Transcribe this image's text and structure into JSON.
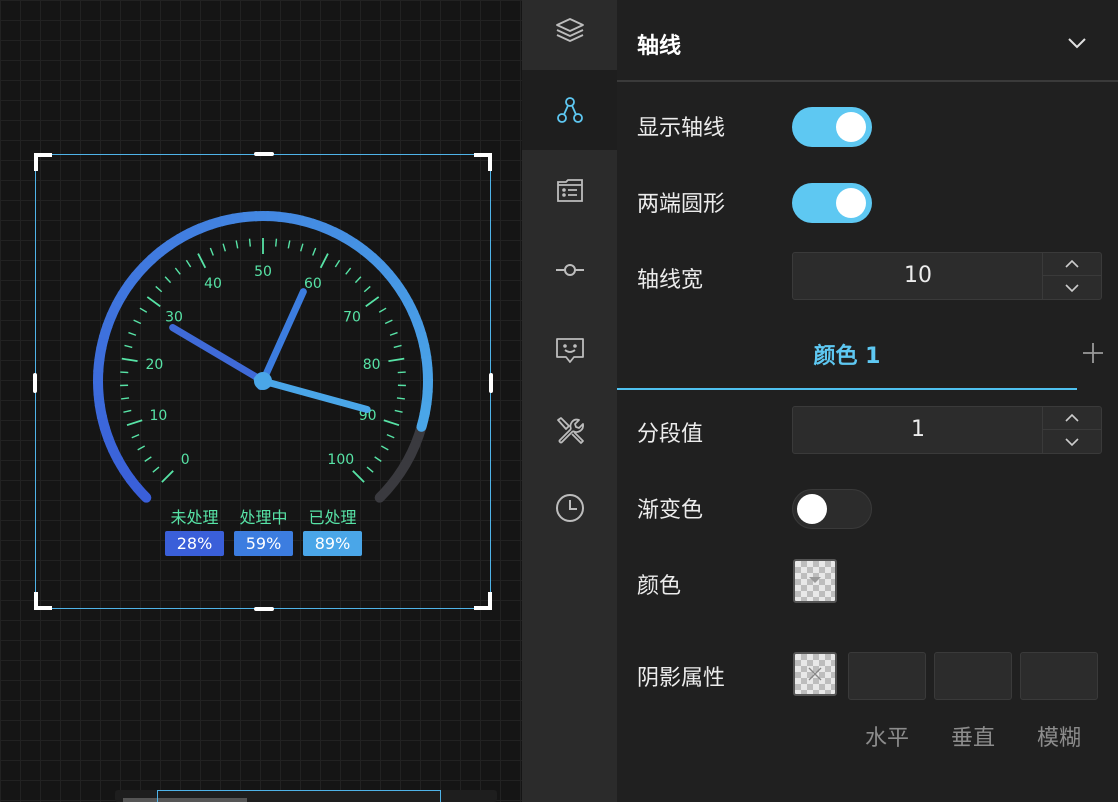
{
  "gauge": {
    "tick_labels": [
      "0",
      "10",
      "20",
      "30",
      "40",
      "50",
      "60",
      "70",
      "80",
      "90",
      "100"
    ],
    "hand_values": [
      28,
      59,
      89
    ],
    "colors": {
      "tick": "#57e3a6",
      "arc_start": "#3a5fd9",
      "arc_end": "#4aa6e8",
      "arc_rest": "#3a3a3f",
      "hand_short": "#3f6ad8",
      "hand_mid": "#3c7de0",
      "hand_long": "#4aa6e8"
    },
    "statuses": [
      {
        "label": "未处理",
        "percent": "28%",
        "color": "#3a5fd9"
      },
      {
        "label": "处理中",
        "percent": "59%",
        "color": "#3c7de0"
      },
      {
        "label": "已处理",
        "percent": "89%",
        "color": "#4aa6e8"
      }
    ]
  },
  "rail": {
    "icons": [
      "layers-icon",
      "nodes-icon",
      "list-icon",
      "commit-icon",
      "chat-icon",
      "tools-icon",
      "clock-icon"
    ],
    "active_index": 1
  },
  "panel": {
    "title": "轴线",
    "rows": {
      "show_axis": {
        "label": "显示轴线",
        "on": true
      },
      "round_ends": {
        "label": "两端圆形",
        "on": true
      },
      "axis_width": {
        "label": "轴线宽",
        "value": "10"
      },
      "segment_value": {
        "label": "分段值",
        "value": "1"
      },
      "gradient": {
        "label": "渐变色",
        "on": false
      },
      "color": {
        "label": "颜色"
      },
      "shadow": {
        "label": "阴影属性"
      }
    },
    "color_tab": "颜色 1",
    "shadow_captions": [
      "水平",
      "垂直",
      "模糊"
    ],
    "accent": "#5ec8f2"
  }
}
